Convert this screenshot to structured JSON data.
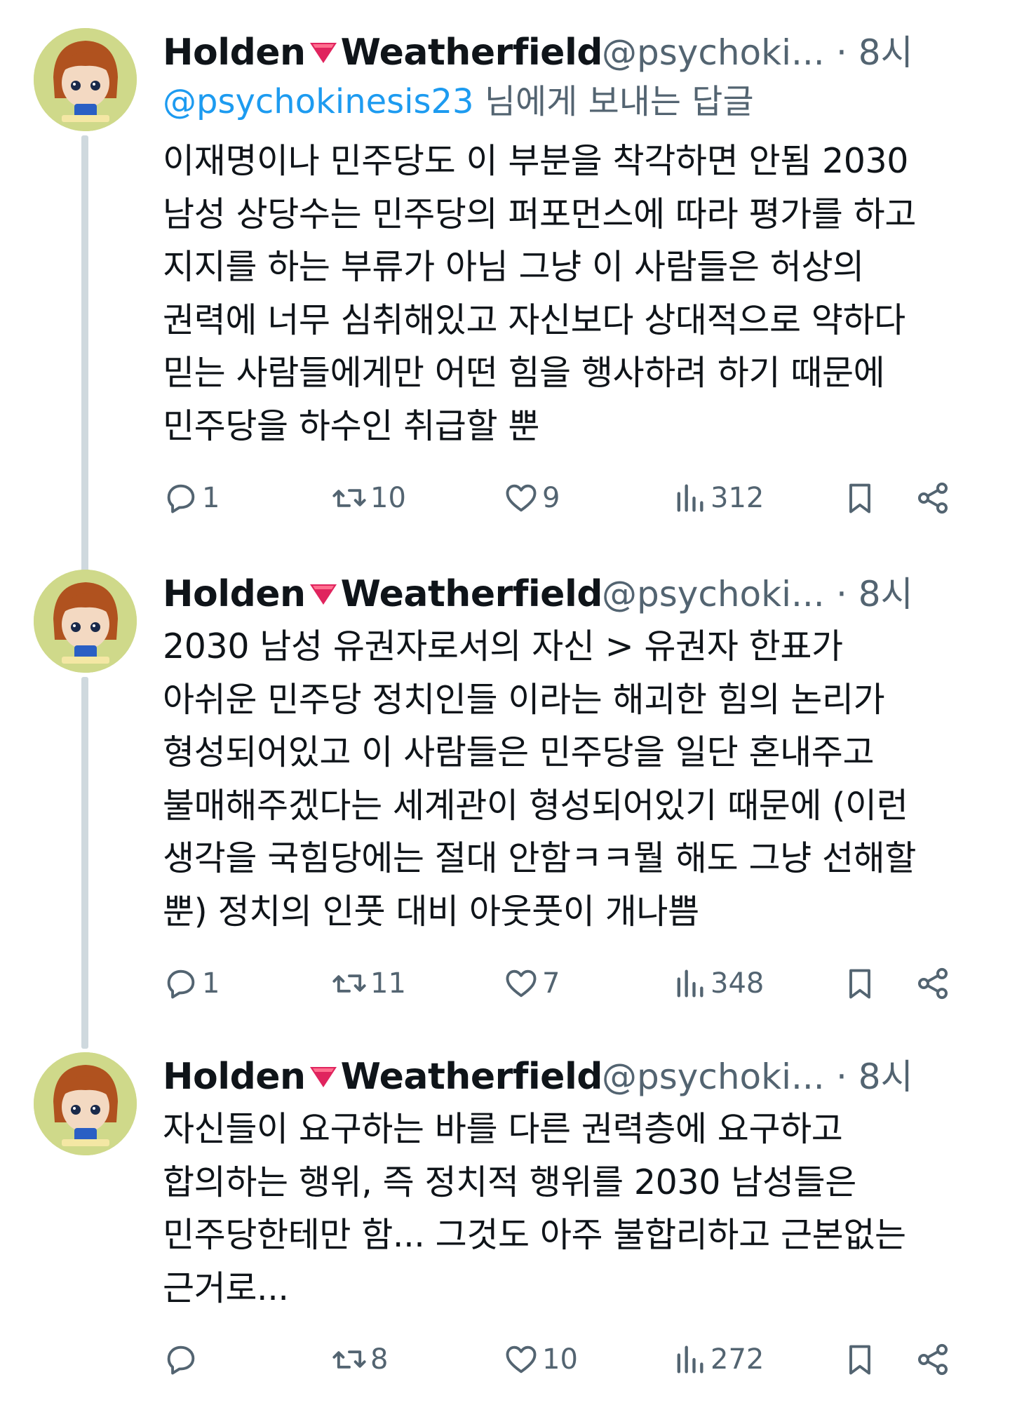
{
  "tweets": [
    {
      "name_first": "Holden",
      "name_last": "Weatherfield",
      "handle": "@psychoki...",
      "time": "· 8시",
      "reply_mention": "@psychokinesis23",
      "reply_suffix": " 님에게 보내는 답글",
      "lines": [
        "이재명이나 민주당도 이 부분을 착각하면 안됨 2030",
        "남성 상당수는 민주당의 퍼포먼스에 따라 평가를 하고",
        "지지를 하는 부류가 아님 그냥 이 사람들은 허상의",
        "권력에 너무 심취해있고 자신보다  상대적으로 약하다",
        "믿는 사람들에게만 어떤 힘을 행사하려 하기 때문에",
        "민주당을 하수인 취급할 뿐"
      ],
      "replies": "1",
      "retweets": "10",
      "likes": "9",
      "views": "312"
    },
    {
      "name_first": "Holden",
      "name_last": "Weatherfield",
      "handle": "@psychoki...",
      "time": "· 8시",
      "lines": [
        "2030 남성 유권자로서의 자신 > 유권자 한표가",
        "아쉬운 민주당 정치인들 이라는 해괴한 힘의 논리가",
        "형성되어있고 이 사람들은 민주당을 일단 혼내주고",
        "불매해주겠다는 세계관이 형성되어있기 때문에 (이런",
        "생각을 국힘당에는 절대 안함ㅋㅋ뭘 해도 그냥 선해할",
        "뿐) 정치의 인풋 대비 아웃풋이 개나쁨"
      ],
      "replies": "1",
      "retweets": "11",
      "likes": "7",
      "views": "348"
    },
    {
      "name_first": "Holden",
      "name_last": "Weatherfield",
      "handle": "@psychoki...",
      "time": "· 8시",
      "lines": [
        "자신들이 요구하는 바를 다른 권력층에 요구하고",
        "합의하는 행위, 즉 정치적 행위를 2030 남성들은",
        "민주당한테만 함... 그것도 아주 불합리하고 근본없는",
        "근거로..."
      ],
      "replies": "",
      "retweets": "8",
      "likes": "10",
      "views": "272"
    }
  ],
  "colors": {
    "text": "#0f1419",
    "secondary": "#536471",
    "link": "#1d9bf0",
    "flag": "#e0245e",
    "thread": "#cfd9de"
  },
  "icons": [
    "reply-icon",
    "retweet-icon",
    "like-icon",
    "views-icon",
    "bookmark-icon",
    "share-icon",
    "more-icon",
    "red-triangle-flag-icon"
  ]
}
